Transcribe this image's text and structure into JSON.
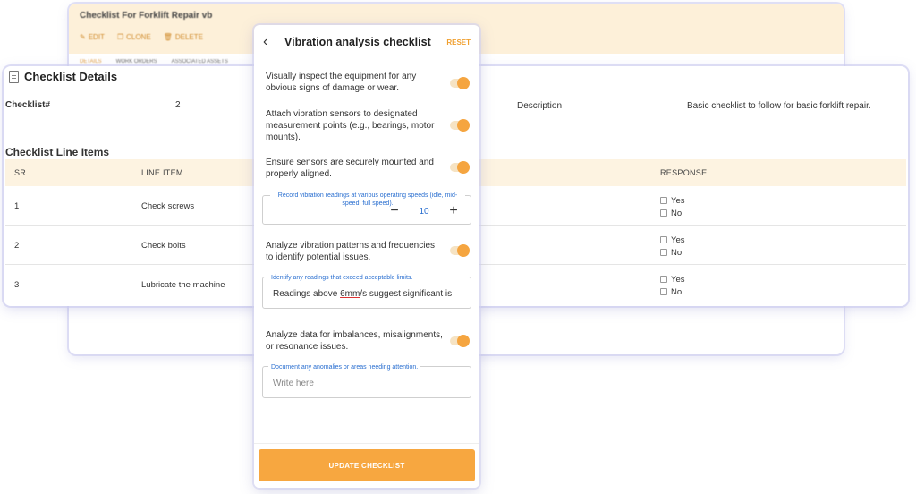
{
  "back_card": {
    "title": "Checklist For Forklift Repair vb",
    "actions": [
      {
        "label": "EDIT",
        "icon": "edit-icon"
      },
      {
        "label": "CLONE",
        "icon": "clone-icon"
      },
      {
        "label": "DELETE",
        "icon": "delete-icon"
      }
    ],
    "tabs": [
      "DETAILS",
      "WORK ORDERS",
      "ASSOCIATED ASSETS"
    ]
  },
  "details": {
    "title": "Checklist Details",
    "checklist_label": "Checklist#",
    "checklist_value": "2",
    "description_label": "Description",
    "description_value": "Basic checklist to follow for basic forklift repair."
  },
  "line_items": {
    "title": "Checklist Line Items",
    "headers": {
      "sr": "SR",
      "item": "LINE ITEM",
      "response": "RESPONSE"
    },
    "rows": [
      {
        "sr": "1",
        "item": "Check screws",
        "yes": "Yes",
        "no": "No"
      },
      {
        "sr": "2",
        "item": "Check bolts",
        "yes": "Yes",
        "no": "No"
      },
      {
        "sr": "3",
        "item": "Lubricate the machine",
        "yes": "Yes",
        "no": "No"
      }
    ]
  },
  "panel": {
    "back_icon": "chevron-left-icon",
    "title": "Vibration analysis checklist",
    "reset": "RESET",
    "items": [
      {
        "text": "Visually inspect the equipment for any obvious signs of damage or wear.",
        "toggle_on": true
      },
      {
        "text": "Attach vibration sensors to designated measurement points (e.g., bearings, motor mounts).",
        "toggle_on": true
      },
      {
        "text": "Ensure sensors are securely mounted and properly aligned.",
        "toggle_on": true
      },
      {
        "text": "Analyze vibration patterns and frequencies to identify potential issues.",
        "toggle_on": true
      },
      {
        "text": "Analyze data for imbalances, misalignments, or resonance issues.",
        "toggle_on": true
      }
    ],
    "readings_field": {
      "legend": "Record vibration readings at various operating speeds (idle, mid-speed, full speed).",
      "value": "10",
      "minus": "−",
      "plus": "+"
    },
    "limits_field": {
      "legend": "Identify any readings that exceed acceptable limits.",
      "value_prefix": "Readings above ",
      "value_underlined": "6mm",
      "value_suffix": "/s suggest significant is"
    },
    "anomalies_field": {
      "legend": "Document any anomalies or areas needing attention.",
      "placeholder": "Write here"
    },
    "update_button": "UPDATE CHECKLIST"
  },
  "colors": {
    "accent": "#f7a740",
    "header_bg": "#fdf3e1",
    "link_blue": "#2a6fd0"
  }
}
